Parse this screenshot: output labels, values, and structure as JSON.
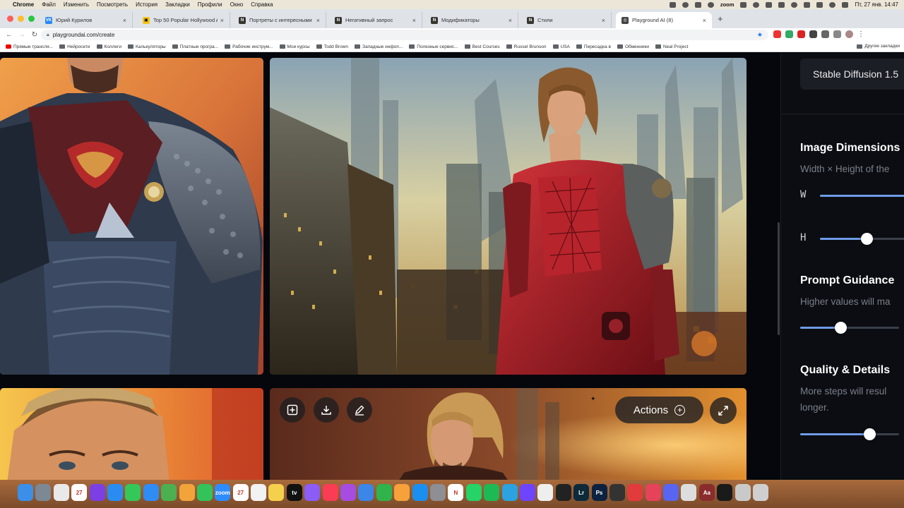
{
  "menubar": {
    "app": "Chrome",
    "items": [
      "Файл",
      "Изменить",
      "Посмотреть",
      "История",
      "Закладки",
      "Профили",
      "Окно",
      "Справка"
    ],
    "zoom_label": "zoom",
    "clock": "Пт, 27 янв. 14:47"
  },
  "tabs": [
    {
      "title": "Юрий Курилов",
      "icon": "vk-icon",
      "color": "#2787f5",
      "glyph": "VK"
    },
    {
      "title": "Top 50 Popular Hollywood Acto",
      "icon": "imdb-icon",
      "color": "#f5c518",
      "glyph": "▣"
    },
    {
      "title": "Портреты с интересными по",
      "icon": "notion-icon",
      "color": "#37352f",
      "glyph": "N"
    },
    {
      "title": "Негативный запрос",
      "icon": "notion-icon",
      "color": "#37352f",
      "glyph": "N"
    },
    {
      "title": "Модификаторы",
      "icon": "notion-icon",
      "color": "#37352f",
      "glyph": "N"
    },
    {
      "title": "Стили",
      "icon": "notion-icon",
      "color": "#37352f",
      "glyph": "N"
    },
    {
      "title": "Playground AI (8)",
      "icon": "playground-icon",
      "color": "#444",
      "glyph": "◎",
      "active": true
    }
  ],
  "address": {
    "url": "playgroundai.com/create"
  },
  "bookmarks": [
    {
      "label": "Прямые трансля...",
      "type": "youtube"
    },
    {
      "label": "Нейросети",
      "type": "folder"
    },
    {
      "label": "Коллеги",
      "type": "folder"
    },
    {
      "label": "Калькуляторы",
      "type": "folder"
    },
    {
      "label": "Платные програ...",
      "type": "folder"
    },
    {
      "label": "Рабочие инструм...",
      "type": "folder"
    },
    {
      "label": "Мои курсы",
      "type": "folder"
    },
    {
      "label": "Todd Brown",
      "type": "folder"
    },
    {
      "label": "Западные инфоп...",
      "type": "folder"
    },
    {
      "label": "Полезные сервис...",
      "type": "folder"
    },
    {
      "label": "Best Courses",
      "type": "folder"
    },
    {
      "label": "Russel Brunson",
      "type": "folder"
    },
    {
      "label": "USA",
      "type": "folder"
    },
    {
      "label": "Пересадка в",
      "type": "folder"
    },
    {
      "label": "Обменники",
      "type": "folder"
    },
    {
      "label": "Neal Project",
      "type": "folder"
    }
  ],
  "bookmarks_other": "Другие закладки",
  "sidebar": {
    "model": "Stable Diffusion 1.5",
    "image_dimensions": {
      "title": "Image Dimensions",
      "desc": "Width × Height of the",
      "w_label": "W",
      "h_label": "H",
      "w_value": 1.0,
      "h_value": 0.47
    },
    "prompt_guidance": {
      "title": "Prompt Guidance",
      "desc": "Higher values will ma",
      "value": 0.41
    },
    "quality": {
      "title": "Quality & Details",
      "desc_line1": "More steps will resul",
      "desc_line2": "longer.",
      "value": 0.7
    }
  },
  "overlay": {
    "actions_label": "Actions",
    "icons": [
      "add-to-canvas-icon",
      "download-icon",
      "edit-icon",
      "expand-icon"
    ]
  },
  "dock": [
    {
      "name": "finder-icon",
      "color": "#3b8fe8"
    },
    {
      "name": "launchpad-icon",
      "color": "#7c8894"
    },
    {
      "name": "chrome-icon",
      "color": "#e9e9e9"
    },
    {
      "name": "calendar-icon",
      "color": "#ffffff",
      "text": "27"
    },
    {
      "name": "firefox-icon",
      "color": "#7b3fe4"
    },
    {
      "name": "safari-icon",
      "color": "#2a8cf2"
    },
    {
      "name": "messages-icon",
      "color": "#34c759"
    },
    {
      "name": "mail-icon",
      "color": "#2f8cf5"
    },
    {
      "name": "maps-icon",
      "color": "#4cb050"
    },
    {
      "name": "photos-icon",
      "color": "#f2a33a"
    },
    {
      "name": "facetime-icon",
      "color": "#32c35a"
    },
    {
      "name": "zoom-icon",
      "color": "#2d8cff",
      "text": "zoom"
    },
    {
      "name": "calendar2-icon",
      "color": "#ffffff",
      "text": "27"
    },
    {
      "name": "reminders-icon",
      "color": "#f2f2f2"
    },
    {
      "name": "notes-icon",
      "color": "#f5d04d"
    },
    {
      "name": "appletv-icon",
      "color": "#111111",
      "text": "tv"
    },
    {
      "name": "messenger-icon",
      "color": "#8b5cf6"
    },
    {
      "name": "music-icon",
      "color": "#fa3c55"
    },
    {
      "name": "podcasts-icon",
      "color": "#a64ce0"
    },
    {
      "name": "keynote-icon",
      "color": "#3b86e6"
    },
    {
      "name": "numbers-icon",
      "color": "#2fb34a"
    },
    {
      "name": "pages-icon",
      "color": "#f6a13a"
    },
    {
      "name": "appstore-icon",
      "color": "#1b8ff0"
    },
    {
      "name": "settings-icon",
      "color": "#8e8e93"
    },
    {
      "name": "notion-icon",
      "color": "#ffffff",
      "text": "N"
    },
    {
      "name": "whatsapp-icon",
      "color": "#25d366"
    },
    {
      "name": "spotify-icon",
      "color": "#1db954"
    },
    {
      "name": "telegram-icon",
      "color": "#2aa3e0"
    },
    {
      "name": "vpn-icon",
      "color": "#6e44ff"
    },
    {
      "name": "script-icon",
      "color": "#eeeeee"
    },
    {
      "name": "speedometer-icon",
      "color": "#222222"
    },
    {
      "name": "lightroom-icon",
      "color": "#0c2a3a",
      "text": "Lr"
    },
    {
      "name": "photoshop-icon",
      "color": "#0b2240",
      "text": "Ps"
    },
    {
      "name": "compass-icon",
      "color": "#333333"
    },
    {
      "name": "readdle-icon",
      "color": "#e23b3b"
    },
    {
      "name": "cleaner-icon",
      "color": "#e6425a"
    },
    {
      "name": "discord-icon",
      "color": "#5865f2"
    },
    {
      "name": "games-icon",
      "color": "#dddddd"
    },
    {
      "name": "dictionary-icon",
      "color": "#8a2c2c",
      "text": "Aa"
    },
    {
      "name": "gpt-icon",
      "color": "#1a1a1a"
    },
    {
      "name": "preview-icon",
      "color": "#c9c9c9"
    },
    {
      "name": "trash-icon",
      "color": "#cfcfcf"
    }
  ]
}
